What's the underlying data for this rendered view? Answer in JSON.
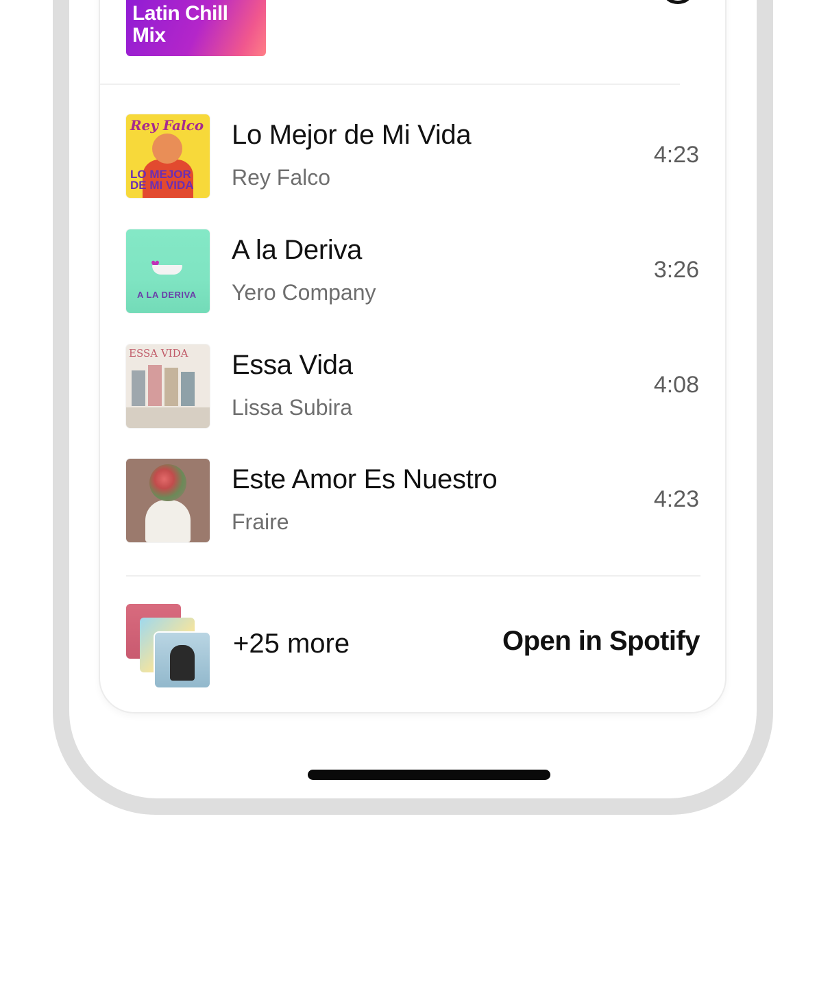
{
  "playlist": {
    "cover_title": "Latin Chill\nMix"
  },
  "tracks": [
    {
      "title": "Lo Mejor de Mi Vida",
      "artist": "Rey Falco",
      "duration": "4:23",
      "art_text_top": "Rey Falco",
      "art_text_bottom": "LO MEJOR DE MI VIDA"
    },
    {
      "title": "A la Deriva",
      "artist": "Yero Company",
      "duration": "3:26",
      "art_text": "A LA DERIVA"
    },
    {
      "title": "Essa Vida",
      "artist": "Lissa Subira",
      "duration": "4:08",
      "art_text": "ESSA VIDA"
    },
    {
      "title": "Este Amor Es Nuestro",
      "artist": "Fraire",
      "duration": "4:23"
    }
  ],
  "footer": {
    "more_label": "+25 more",
    "open_label": "Open in Spotify"
  },
  "colors": {
    "accent_gradient_start": "#8a1bd6",
    "accent_gradient_end": "#ff7f86",
    "text_primary": "#111111",
    "text_secondary": "#6e6e6e"
  }
}
